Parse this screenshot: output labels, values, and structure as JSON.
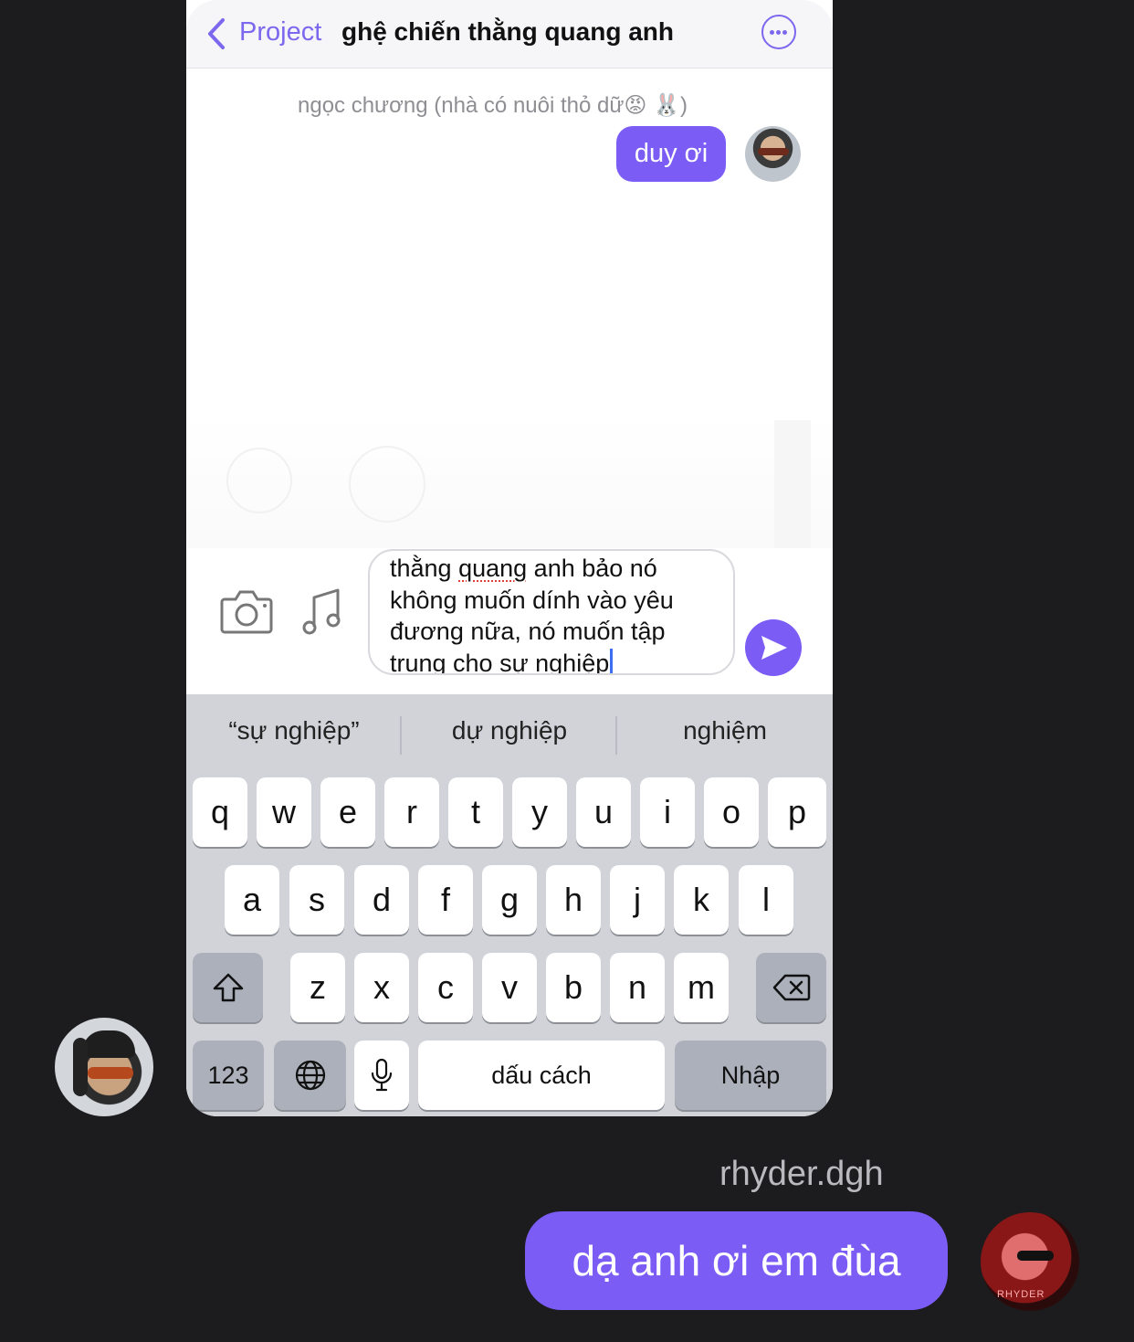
{
  "header": {
    "back_label": "Project",
    "title": "ghệ chiến thằng quang anh"
  },
  "chat": {
    "sender_name": "ngọc chương (nhà có nuôi thỏ dữ😡 🐰)",
    "message": "duy ơi"
  },
  "composer": {
    "lines": [
      "thằng quang anh bảo nó",
      "không muốn dính vào yêu",
      "đương nữa, nó muốn tập",
      "trung cho sự nghiệp"
    ],
    "misspelled_word": "quang"
  },
  "keyboard": {
    "suggestions": [
      "“sự nghiệp”",
      "dự nghiệp",
      "nghiệm"
    ],
    "row1": [
      "q",
      "w",
      "e",
      "r",
      "t",
      "y",
      "u",
      "i",
      "o",
      "p"
    ],
    "row2": [
      "a",
      "s",
      "d",
      "f",
      "g",
      "h",
      "j",
      "k",
      "l"
    ],
    "row3": [
      "z",
      "x",
      "c",
      "v",
      "b",
      "n",
      "m"
    ],
    "numbers_label": "123",
    "space_label": "dấu cách",
    "return_label": "Nhập"
  },
  "reply": {
    "username": "rhyder.dgh",
    "message": "dạ anh ơi em đùa",
    "avatar_text": "RHYDER"
  }
}
